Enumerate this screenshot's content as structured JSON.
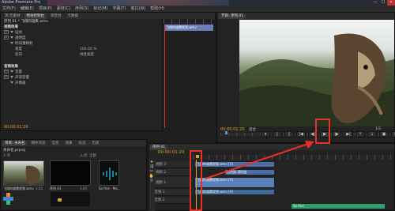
{
  "app": {
    "title": "Adobe Premiere Pro",
    "window_controls": [
      "—",
      "☐",
      "✕"
    ]
  },
  "menu": [
    "文件(F)",
    "编辑(E)",
    "项目(P)",
    "素材(C)",
    "序列(S)",
    "标记(M)",
    "字幕(T)",
    "窗口(W)",
    "帮助(H)"
  ],
  "effect_controls": {
    "tabs": [
      "源:无素材",
      "特效控制台",
      "调音台",
      "元数据"
    ],
    "sequence_label": "序列 01 * 飞翔的雄鹰.wmv",
    "sections": {
      "video_effects": "视频效果",
      "motion": "运动",
      "opacity": "透明度",
      "time_remap": "时间重映射",
      "speed": "速度",
      "speed_value": "100.00 %",
      "reverse": "反向",
      "reverse_value": "线性速度",
      "audio_effects": "音频效果",
      "volume": "音量",
      "channel_volume": "声道音量",
      "panner": "声像器"
    },
    "clip_label": "飞翔的雄鹰视频.wmv",
    "timecode": "00:00:01:20"
  },
  "program": {
    "tab": "节目: 序列 01",
    "timecode": "00:00:01:20",
    "fit": "适合",
    "ratio": "1/2"
  },
  "project": {
    "tabs": [
      "项目: 未命名",
      "媒体浏览",
      "信息",
      "效果",
      "标记",
      "历史"
    ],
    "name": "未命名.prproj",
    "item_count": "3 项",
    "in_label": "入点: 全部",
    "items": [
      {
        "name": "飞翔的雄鹰视频.wmv",
        "meta": "3:20"
      },
      {
        "name": "序列 01",
        "meta": "3:20"
      },
      {
        "name": "So fine - Ma... ",
        "meta": "2:40:10000"
      }
    ],
    "bottom_timecode": "00:00:01:20"
  },
  "timeline": {
    "tab": "序列 01",
    "timecode": "00:00:01:20",
    "tracks": [
      "视频 3",
      "视频 2",
      "视频 1",
      "音频 1",
      "音频 2"
    ],
    "clips": [
      {
        "label": "飞翔的雄鹰视频.wmv [V]",
        "color": "#4a6fa8"
      },
      {
        "label": "透明度:透明度",
        "color": "#4a6fa8"
      },
      {
        "label": "飞翔的雄鹰视频.wmv [V]",
        "color": "#5b7fb8"
      },
      {
        "label": "飞翔的雄鹰视频.wmv [A]",
        "color": "#3f6a9a"
      },
      {
        "label": "So fine",
        "color": "#2f9e6a"
      }
    ]
  },
  "accent": {
    "highlight": "#e5312a",
    "timecode": "#e0a020"
  }
}
